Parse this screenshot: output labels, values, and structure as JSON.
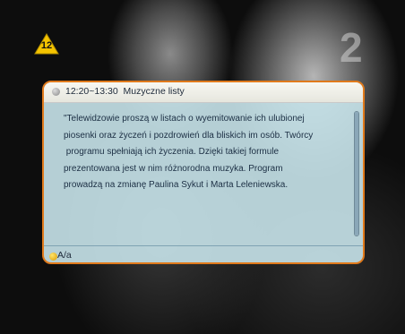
{
  "age_rating": {
    "label": "12",
    "color": "#f5c400"
  },
  "channel_logo": {
    "text": "2"
  },
  "epg_info": {
    "time_range": "12:20~13:30",
    "program_title": "Muzyczne listy",
    "description_lines": [
      "\"Telewidzowie proszą w listach o wyemitowanie ich ulubionej",
      "piosenki oraz życzeń i pozdrowień dla bliskich im osób. Twórcy",
      " programu spełniają ich życzenia. Dzięki takiej formule",
      "prezentowana jest w nim różnorodna muzyka. Program",
      "prowadzą na zmianę Paulina Sykut i Marta Leleniewska."
    ],
    "footer_key_label": "A/a",
    "accent_color": "#e07a1c",
    "footer_key_color": "#f2c000"
  }
}
